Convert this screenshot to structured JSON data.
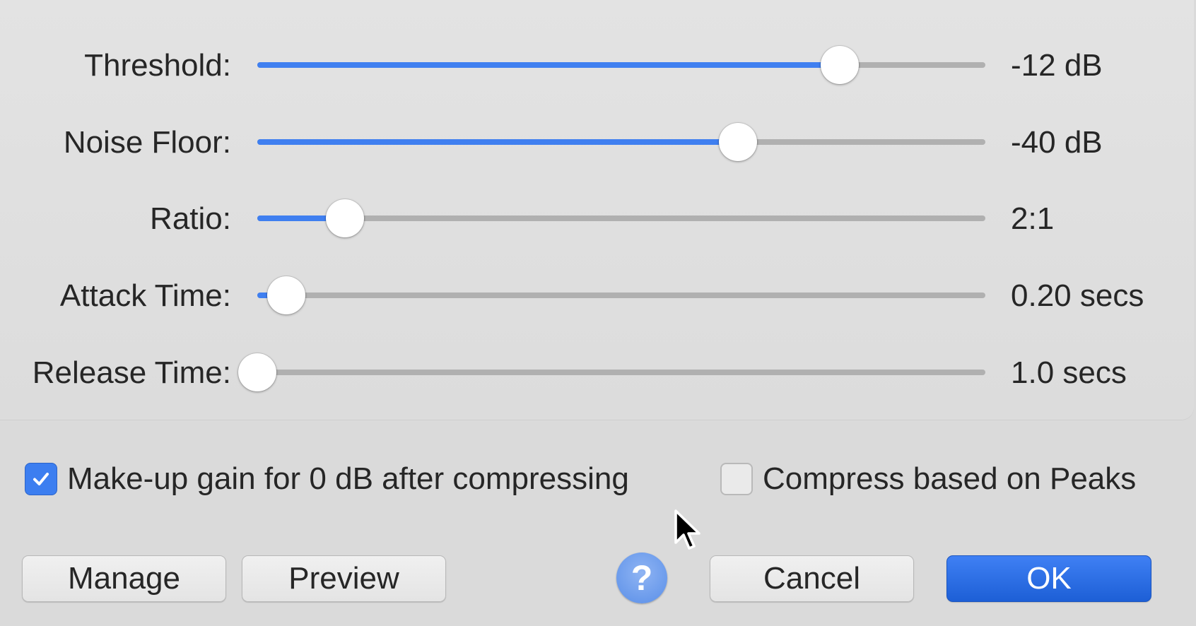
{
  "dialog": {
    "sliders": [
      {
        "label": "Threshold:",
        "value": "-12 dB",
        "fraction": 0.8
      },
      {
        "label": "Noise Floor:",
        "value": "-40 dB",
        "fraction": 0.66
      },
      {
        "label": "Ratio:",
        "value": "2:1",
        "fraction": 0.12
      },
      {
        "label": "Attack Time:",
        "value": "0.20 secs",
        "fraction": 0.04
      },
      {
        "label": "Release Time:",
        "value": "1.0 secs",
        "fraction": 0.0
      }
    ],
    "options": {
      "makeup_gain": {
        "label": "Make-up gain for 0 dB after compressing",
        "checked": true
      },
      "compress_peaks": {
        "label": "Compress based on Peaks",
        "checked": false
      }
    },
    "buttons": {
      "manage": "Manage",
      "preview": "Preview",
      "help": "?",
      "cancel": "Cancel",
      "ok": "OK"
    },
    "colors": {
      "accent": "#3f7ff0",
      "track": "#b0b0b0",
      "ok_button": "#1d5fd6"
    },
    "icons": {
      "help": "question-icon",
      "checkmark": "checkmark-icon",
      "cursor": "mouse-pointer-icon"
    }
  }
}
